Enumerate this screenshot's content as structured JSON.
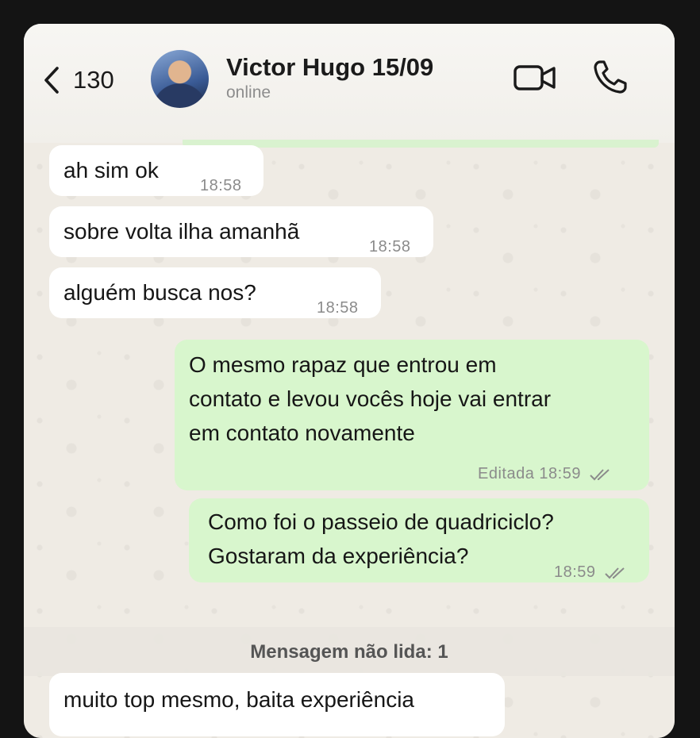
{
  "header": {
    "back_count": "130",
    "contact_name": "Victor Hugo 15/09",
    "status": "online"
  },
  "messages": [
    {
      "direction": "in",
      "text": "ah sim ok",
      "time": "18:58"
    },
    {
      "direction": "in",
      "text": "sobre volta ilha amanhã",
      "time": "18:58"
    },
    {
      "direction": "in",
      "text": "alguém busca nos?",
      "time": "18:58"
    },
    {
      "direction": "out",
      "lines": [
        "O mesmo rapaz que entrou em",
        "contato e levou vocês hoje vai entrar",
        "em contato novamente"
      ],
      "edited_label": "Editada",
      "time": "18:59",
      "read": true
    },
    {
      "direction": "out",
      "lines": [
        "Como foi o passeio de quadriciclo?",
        "Gostaram da experiência?"
      ],
      "time": "18:59",
      "read": true
    },
    {
      "direction": "in",
      "text": "muito top mesmo, baita experiência"
    }
  ],
  "unread_banner": "Mensagem não lida: 1",
  "colors": {
    "incoming_bubble": "#ffffff",
    "outgoing_bubble": "#d8f6cd",
    "chat_background": "#efebe4"
  },
  "icons": [
    "chevron-left-icon",
    "video-call-icon",
    "phone-call-icon",
    "double-check-icon"
  ]
}
